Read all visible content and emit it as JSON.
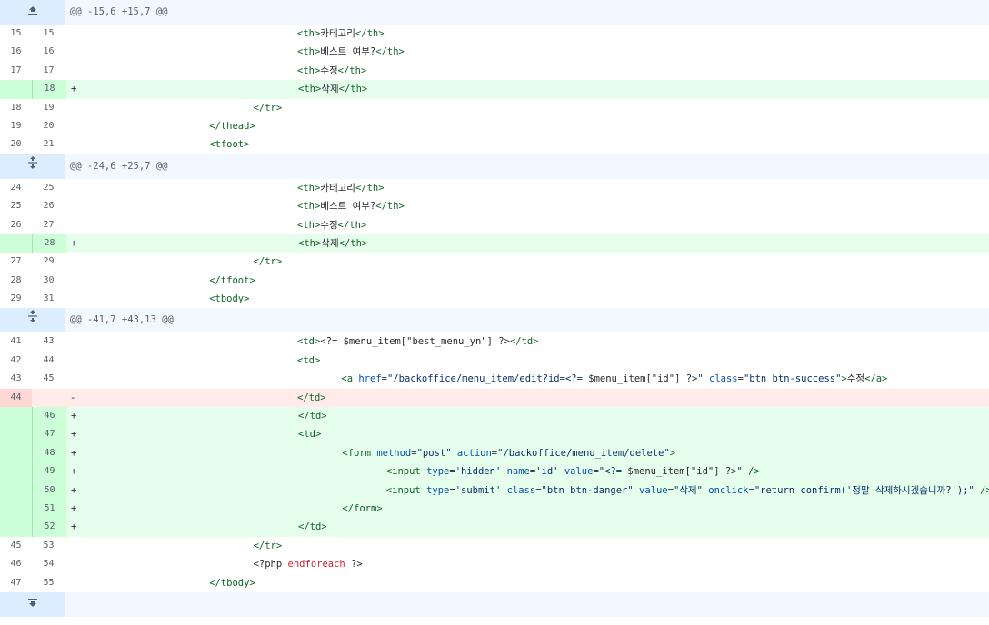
{
  "hunks": [
    {
      "header": "@@ -15,6 +15,7 @@",
      "expand_icon": "expand-up-icon",
      "lines": [
        {
          "type": "ctx",
          "old": "15",
          "new": "15",
          "sign": "",
          "indent": 20,
          "segs": [
            [
              "t",
              "<th>"
            ],
            [
              "p",
              "카테고리"
            ],
            [
              "t",
              "</th>"
            ]
          ]
        },
        {
          "type": "ctx",
          "old": "16",
          "new": "16",
          "sign": "",
          "indent": 20,
          "segs": [
            [
              "t",
              "<th>"
            ],
            [
              "p",
              "베스트 여부?"
            ],
            [
              "t",
              "</th>"
            ]
          ]
        },
        {
          "type": "ctx",
          "old": "17",
          "new": "17",
          "sign": "",
          "indent": 20,
          "segs": [
            [
              "t",
              "<th>"
            ],
            [
              "p",
              "수정"
            ],
            [
              "t",
              "</th>"
            ]
          ]
        },
        {
          "type": "add",
          "old": "",
          "new": "18",
          "sign": "+",
          "indent": 20,
          "segs": [
            [
              "t",
              "<th>"
            ],
            [
              "p",
              "삭제"
            ],
            [
              "t",
              "</th>"
            ]
          ]
        },
        {
          "type": "ctx",
          "old": "18",
          "new": "19",
          "sign": "",
          "indent": 16,
          "segs": [
            [
              "t",
              "</tr>"
            ]
          ]
        },
        {
          "type": "ctx",
          "old": "19",
          "new": "20",
          "sign": "",
          "indent": 12,
          "segs": [
            [
              "t",
              "</thead>"
            ]
          ]
        },
        {
          "type": "ctx",
          "old": "20",
          "new": "21",
          "sign": "",
          "indent": 12,
          "segs": [
            [
              "t",
              "<tfoot>"
            ]
          ]
        }
      ]
    },
    {
      "header": "@@ -24,6 +25,7 @@",
      "expand_icon": "expand-both-icon",
      "lines": [
        {
          "type": "ctx",
          "old": "24",
          "new": "25",
          "sign": "",
          "indent": 20,
          "segs": [
            [
              "t",
              "<th>"
            ],
            [
              "p",
              "카테고리"
            ],
            [
              "t",
              "</th>"
            ]
          ]
        },
        {
          "type": "ctx",
          "old": "25",
          "new": "26",
          "sign": "",
          "indent": 20,
          "segs": [
            [
              "t",
              "<th>"
            ],
            [
              "p",
              "베스트 여부?"
            ],
            [
              "t",
              "</th>"
            ]
          ]
        },
        {
          "type": "ctx",
          "old": "26",
          "new": "27",
          "sign": "",
          "indent": 20,
          "segs": [
            [
              "t",
              "<th>"
            ],
            [
              "p",
              "수정"
            ],
            [
              "t",
              "</th>"
            ]
          ]
        },
        {
          "type": "add",
          "old": "",
          "new": "28",
          "sign": "+",
          "indent": 20,
          "segs": [
            [
              "t",
              "<th>"
            ],
            [
              "p",
              "삭제"
            ],
            [
              "t",
              "</th>"
            ]
          ]
        },
        {
          "type": "ctx",
          "old": "27",
          "new": "29",
          "sign": "",
          "indent": 16,
          "segs": [
            [
              "t",
              "</tr>"
            ]
          ]
        },
        {
          "type": "ctx",
          "old": "28",
          "new": "30",
          "sign": "",
          "indent": 12,
          "segs": [
            [
              "t",
              "</tfoot>"
            ]
          ]
        },
        {
          "type": "ctx",
          "old": "29",
          "new": "31",
          "sign": "",
          "indent": 12,
          "segs": [
            [
              "t",
              "<tbody>"
            ]
          ]
        }
      ]
    },
    {
      "header": "@@ -41,7 +43,13 @@",
      "expand_icon": "expand-both-icon",
      "lines": [
        {
          "type": "ctx",
          "old": "41",
          "new": "43",
          "sign": "",
          "indent": 20,
          "segs": [
            [
              "t",
              "<td>"
            ],
            [
              "p",
              "<?= $menu_item[\"best_menu_yn\"] ?>"
            ],
            [
              "t",
              "</td>"
            ]
          ]
        },
        {
          "type": "ctx",
          "old": "42",
          "new": "44",
          "sign": "",
          "indent": 20,
          "segs": [
            [
              "t",
              "<td>"
            ]
          ]
        },
        {
          "type": "ctx",
          "old": "43",
          "new": "45",
          "sign": "",
          "indent": 24,
          "segs": [
            [
              "t",
              "<a "
            ],
            [
              "a",
              "href"
            ],
            [
              "p",
              "="
            ],
            [
              "s",
              "\"/backoffice/menu_item/edit?id=<?= "
            ],
            [
              "p",
              "$menu_item[\"id\"] ?>"
            ],
            [
              "s",
              "\""
            ],
            [
              "p",
              " "
            ],
            [
              "a",
              "class"
            ],
            [
              "p",
              "="
            ],
            [
              "s",
              "\"btn btn-success\""
            ],
            [
              "t",
              ">"
            ],
            [
              "p",
              "수정"
            ],
            [
              "t",
              "</a>"
            ]
          ]
        },
        {
          "type": "del",
          "old": "44",
          "new": "",
          "sign": "-",
          "indent": 20,
          "segs": [
            [
              "t",
              "</td>"
            ]
          ]
        },
        {
          "type": "add",
          "old": "",
          "new": "46",
          "sign": "+",
          "indent": 20,
          "segs": [
            [
              "t",
              "</td>"
            ]
          ]
        },
        {
          "type": "add",
          "old": "",
          "new": "47",
          "sign": "+",
          "indent": 20,
          "segs": [
            [
              "t",
              "<td>"
            ]
          ]
        },
        {
          "type": "add",
          "old": "",
          "new": "48",
          "sign": "+",
          "indent": 24,
          "segs": [
            [
              "t",
              "<form "
            ],
            [
              "a",
              "method"
            ],
            [
              "p",
              "="
            ],
            [
              "s",
              "\"post\""
            ],
            [
              "p",
              " "
            ],
            [
              "a",
              "action"
            ],
            [
              "p",
              "="
            ],
            [
              "s",
              "\"/backoffice/menu_item/delete\""
            ],
            [
              "t",
              ">"
            ]
          ]
        },
        {
          "type": "add",
          "old": "",
          "new": "49",
          "sign": "+",
          "indent": 28,
          "segs": [
            [
              "t",
              "<input "
            ],
            [
              "a",
              "type"
            ],
            [
              "p",
              "="
            ],
            [
              "s",
              "'hidden'"
            ],
            [
              "p",
              " "
            ],
            [
              "a",
              "name"
            ],
            [
              "p",
              "="
            ],
            [
              "s",
              "'id'"
            ],
            [
              "p",
              " "
            ],
            [
              "a",
              "value"
            ],
            [
              "p",
              "="
            ],
            [
              "s",
              "\"<?= "
            ],
            [
              "p",
              "$menu_item[\"id\"] ?>"
            ],
            [
              "s",
              "\""
            ],
            [
              "p",
              " "
            ],
            [
              "t",
              "/>"
            ]
          ]
        },
        {
          "type": "add",
          "old": "",
          "new": "50",
          "sign": "+",
          "indent": 28,
          "segs": [
            [
              "t",
              "<input "
            ],
            [
              "a",
              "type"
            ],
            [
              "p",
              "="
            ],
            [
              "s",
              "'submit'"
            ],
            [
              "p",
              " "
            ],
            [
              "a",
              "class"
            ],
            [
              "p",
              "="
            ],
            [
              "s",
              "\"btn btn-danger\""
            ],
            [
              "p",
              " "
            ],
            [
              "a",
              "value"
            ],
            [
              "p",
              "="
            ],
            [
              "s",
              "\"삭제\""
            ],
            [
              "p",
              " "
            ],
            [
              "a",
              "onclick"
            ],
            [
              "p",
              "="
            ],
            [
              "s",
              "\"return confirm('정말 삭제하시겠습니까?');\""
            ],
            [
              "p",
              " "
            ],
            [
              "t",
              "/>"
            ]
          ]
        },
        {
          "type": "add",
          "old": "",
          "new": "51",
          "sign": "+",
          "indent": 24,
          "segs": [
            [
              "t",
              "</form>"
            ]
          ]
        },
        {
          "type": "add",
          "old": "",
          "new": "52",
          "sign": "+",
          "indent": 20,
          "segs": [
            [
              "t",
              "</td>"
            ]
          ]
        },
        {
          "type": "ctx",
          "old": "45",
          "new": "53",
          "sign": "",
          "indent": 16,
          "segs": [
            [
              "t",
              "</tr>"
            ]
          ]
        },
        {
          "type": "ctx",
          "old": "46",
          "new": "54",
          "sign": "",
          "indent": 16,
          "segs": [
            [
              "p",
              "<?php "
            ],
            [
              "k",
              "endforeach"
            ],
            [
              "p",
              " ?>"
            ]
          ]
        },
        {
          "type": "ctx",
          "old": "47",
          "new": "55",
          "sign": "",
          "indent": 12,
          "segs": [
            [
              "t",
              "</tbody>"
            ]
          ]
        }
      ]
    }
  ],
  "footer": {
    "expand_icon": "expand-down-icon"
  },
  "colors": {
    "hunk_bg": "#f1f8ff",
    "hunk_num_bg": "#dbedff",
    "add_bg": "#e6ffec",
    "add_num_bg": "#ccffd8",
    "del_bg": "#ffebe9",
    "del_num_bg": "#ffd7d5"
  }
}
